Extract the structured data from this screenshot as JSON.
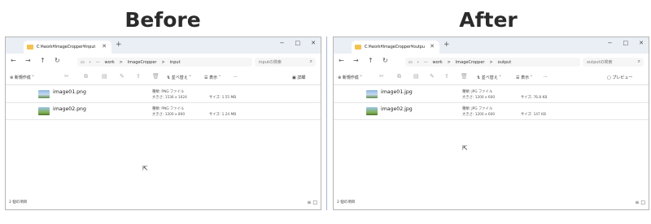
{
  "headings": {
    "before": "Before",
    "after": "After"
  },
  "before": {
    "tab_title": "C:¥work¥ImageCropper¥input",
    "address": [
      "···",
      "work",
      ">",
      "ImageCropper",
      ">",
      "input"
    ],
    "search_placeholder": "inputの検索",
    "toolbar": {
      "new": "新規作成",
      "sort": "並べ替え",
      "view": "表示",
      "more": "···",
      "details": "詳細"
    },
    "files": [
      {
        "name": "image01.png",
        "type": "種類: PNG ファイル",
        "dims": "大きさ: 1536 x 1024",
        "size": "サイズ: 1.55 MB"
      },
      {
        "name": "image02.png",
        "type": "種類: PNG ファイル",
        "dims": "大きさ: 1200 x 800",
        "size": "サイズ: 1.24 MB"
      }
    ],
    "status": "2 個の項目"
  },
  "after": {
    "tab_title": "C:¥work¥ImageCropper¥outpu",
    "address": [
      "···",
      "work",
      ">",
      "ImageCropper",
      ">",
      "output"
    ],
    "search_placeholder": "outputの検索",
    "toolbar": {
      "new": "新規作成",
      "sort": "並べ替え",
      "view": "表示",
      "more": "···",
      "details": "プレビュー"
    },
    "files": [
      {
        "name": "image01.jpg",
        "type": "種類: JPG ファイル",
        "dims": "大きさ: 1200 x 600",
        "size": "サイズ: 76.8 KB"
      },
      {
        "name": "image02.jpg",
        "type": "種類: JPG ファイル",
        "dims": "大きさ: 1200 x 600",
        "size": "サイズ: 147 KB"
      }
    ],
    "status": "2 個の項目"
  }
}
